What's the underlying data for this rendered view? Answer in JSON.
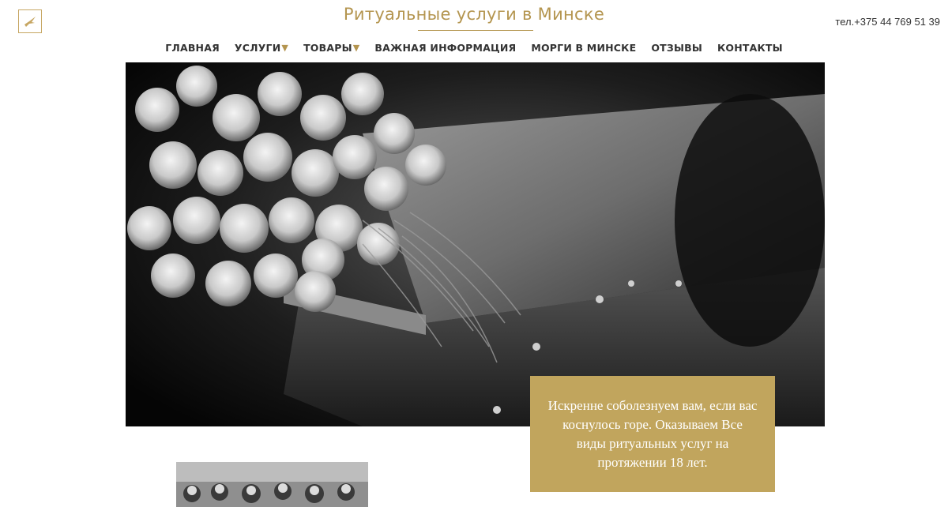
{
  "header": {
    "logo_icon": "dove-logo-icon",
    "site_title": "Ритуальные услуги в Минске",
    "phone": "тел.+375 44 769 51 39"
  },
  "nav": {
    "items": [
      {
        "label": "ГЛАВНАЯ",
        "has_dropdown": false
      },
      {
        "label": "УСЛУГИ",
        "has_dropdown": true
      },
      {
        "label": "ТОВАРЫ",
        "has_dropdown": true
      },
      {
        "label": "ВАЖНАЯ ИНФОРМАЦИЯ",
        "has_dropdown": false
      },
      {
        "label": "МОРГИ В МИНСКЕ",
        "has_dropdown": false
      },
      {
        "label": "ОТЗЫВЫ",
        "has_dropdown": false
      },
      {
        "label": "КОНТАКТЫ",
        "has_dropdown": false
      }
    ],
    "dropdown_icon": "triangle-down-icon"
  },
  "hero": {
    "image": "coffin-with-white-roses-photo"
  },
  "message": {
    "text": "Искренне соболезнуем вам, если вас коснулось горе. Оказываем Все виды ритуальных услуг на протяжении 18 лет."
  },
  "thumbnail": {
    "image": "mourners-photo"
  },
  "colors": {
    "accent_gold": "#c1a55d",
    "title_gold": "#b4954f",
    "text_dark": "#333333"
  }
}
